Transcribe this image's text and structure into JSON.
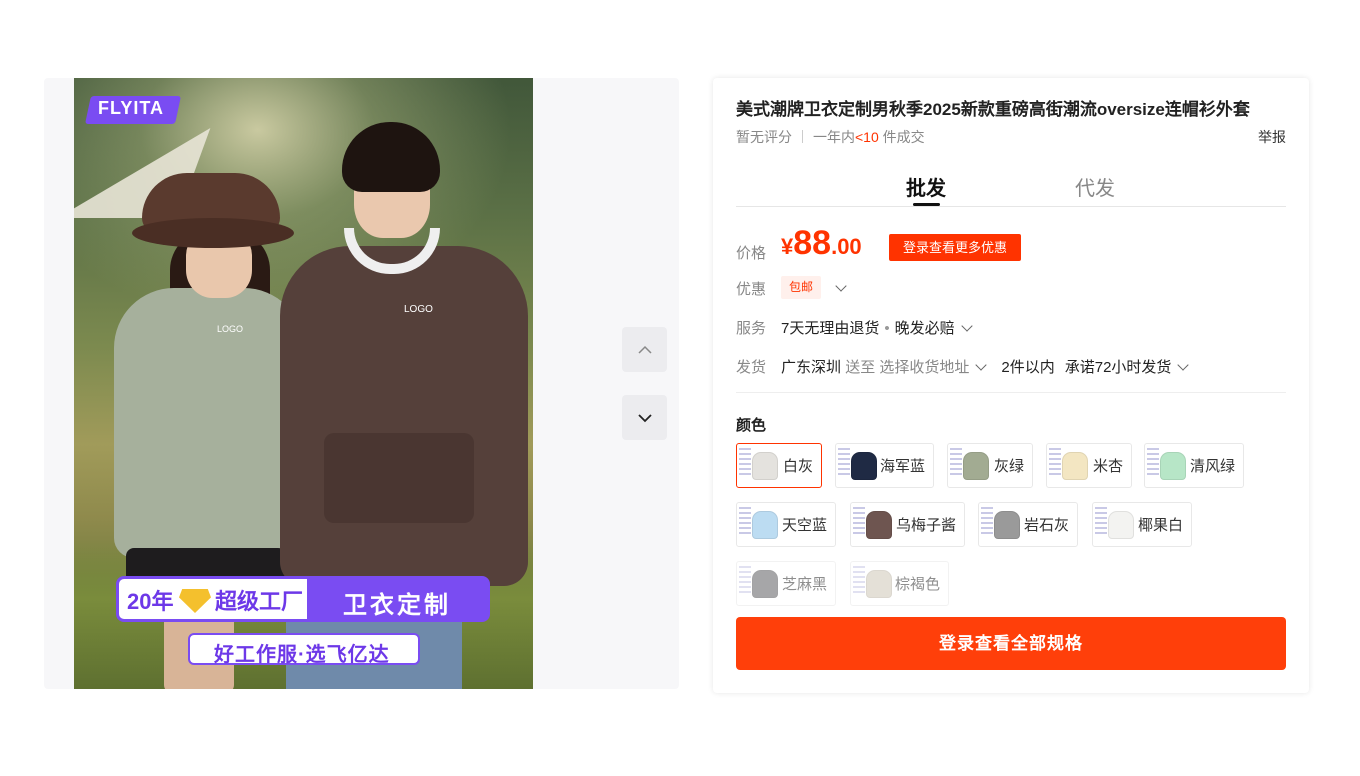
{
  "gallery": {
    "brand_badge": "FLYITA",
    "garment_logo_left": "LOGO",
    "garment_logo_right": "LOGO",
    "banner_years": "20年",
    "banner_factory": "超级工厂",
    "banner_custom": "卫衣定制",
    "banner_slogan": "好工作服·选飞亿达",
    "nav_up_icon": "chevron-up-icon",
    "nav_down_icon": "chevron-down-icon"
  },
  "product": {
    "title": "美式潮牌卫衣定制男秋季2025新款重磅高街潮流oversize连帽衫外套",
    "rating_text": "暂无评分",
    "sales_prefix": "一年内",
    "sales_count": "<10",
    "sales_suffix": "件成交",
    "report": "举报"
  },
  "tabs": [
    {
      "label": "批发",
      "active": true
    },
    {
      "label": "代发",
      "active": false
    }
  ],
  "price": {
    "label": "价格",
    "symbol": "¥",
    "integer": "88",
    "decimal": ".00",
    "login_deal": "登录查看更多优惠"
  },
  "promotion": {
    "label": "优惠",
    "tag": "包邮"
  },
  "service": {
    "label": "服务",
    "item1": "7天无理由退货",
    "dot": "•",
    "item2": "晚发必赔"
  },
  "shipping": {
    "label": "发货",
    "origin": "广东深圳",
    "to": "送至",
    "address": "选择收货地址",
    "quantity": "2件以内",
    "promise": "承诺72小时发货"
  },
  "colors": {
    "title": "颜色",
    "options": [
      {
        "label": "白灰",
        "hex": "#e4e2de",
        "selected": true
      },
      {
        "label": "海军蓝",
        "hex": "#1f2a44",
        "selected": false
      },
      {
        "label": "灰绿",
        "hex": "#a2ab92",
        "selected": false
      },
      {
        "label": "米杏",
        "hex": "#f3e6c2",
        "selected": false
      },
      {
        "label": "清风绿",
        "hex": "#b7e6c7",
        "selected": false
      },
      {
        "label": "天空蓝",
        "hex": "#bcdcf2",
        "selected": false
      },
      {
        "label": "乌梅子酱",
        "hex": "#6e5550",
        "selected": false
      },
      {
        "label": "岩石灰",
        "hex": "#9a9a9a",
        "selected": false
      },
      {
        "label": "椰果白",
        "hex": "#f3f3f1",
        "selected": false
      },
      {
        "label": "芝麻黑",
        "hex": "#5f5f62",
        "selected": false
      },
      {
        "label": "棕褐色",
        "hex": "#cfc8b8",
        "selected": false
      }
    ]
  },
  "cta": {
    "label": "登录查看全部规格"
  },
  "theme": {
    "accent": "#ff3300",
    "brand_purple": "#7a4cf2"
  }
}
